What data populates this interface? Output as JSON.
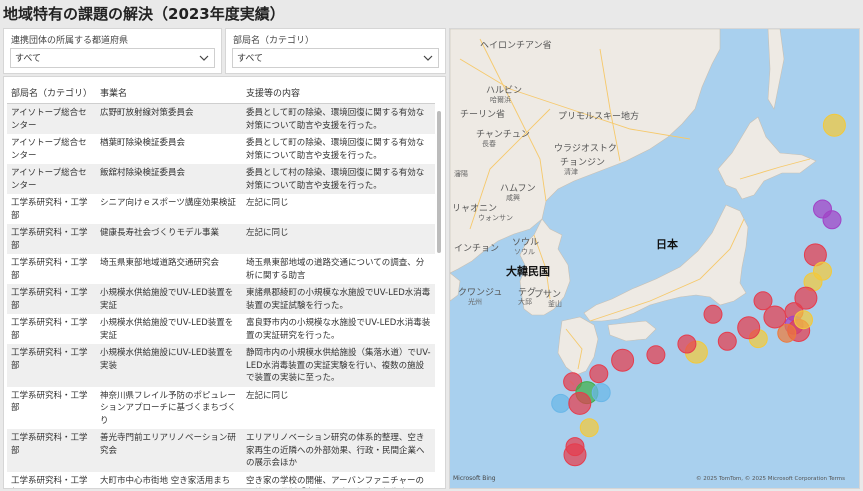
{
  "title": "地域特有の課題の解決（2023年度実績）",
  "slicer_pref": {
    "label": "連携団体の所属する都道府県",
    "value": "すべて"
  },
  "slicer_dept": {
    "label": "部局名（カテゴリ）",
    "value": "すべて"
  },
  "table": {
    "headers": [
      "部局名（カテゴリ）",
      "事業名",
      "支援等の内容"
    ],
    "rows": [
      [
        "アイソトープ総合センター",
        "広野町放射線対策委員会",
        "委員として町の除染、環境回復に関する有効な対策について助言や支援を行った。"
      ],
      [
        "アイソトープ総合センター",
        "楢葉町除染検証委員会",
        "委員として町の除染、環境回復に関する有効な対策について助言や支援を行った。"
      ],
      [
        "アイソトープ総合センター",
        "飯舘村除染検証委員会",
        "委員として村の除染、環境回復に関する有効な対策について助言や支援を行った。"
      ],
      [
        "工学系研究科・工学部",
        "シニア向けｅスポーツ講座効果検証",
        "左記に同じ"
      ],
      [
        "工学系研究科・工学部",
        "健康長寿社会づくりモデル事業",
        "左記に同じ"
      ],
      [
        "工学系研究科・工学部",
        "埼玉県東部地域道路交通研究会",
        "埼玉県東部地域の道路交通についての調査、分析に関する助言"
      ],
      [
        "工学系研究科・工学部",
        "小規模水供給施設でUV-LED装置を実証",
        "東諸県郡綾町の小規模な水施設でUV-LED水消毒装置の実証試験を行った。"
      ],
      [
        "工学系研究科・工学部",
        "小規模水供給施設でUV-LED装置を実証",
        "富良野市内の小規模な水施設でUV-LED水消毒装置の実証研究を行った。"
      ],
      [
        "工学系研究科・工学部",
        "小規模水供給施設にUV-LED装置を実装",
        "静岡市内の小規模水供給施設（集落水道）でUV-LED水消毒装置の実証実験を行い、複数の施設で装置の実装に至った。"
      ],
      [
        "工学系研究科・工学部",
        "神奈川県フレイル予防のポピュレーションアプローチに基づくまちづくり",
        "左記に同じ"
      ],
      [
        "工学系研究科・工学部",
        "善光寺門前エリアリノベーション研究会",
        "エリアリノベーション研究の体系的整理、空き家再生の近隣への外部効果、行政・民間企業への展示会ほか"
      ],
      [
        "工学系研究科・工学部",
        "大町市中心市街地 空き家活用まちづくり",
        "空き家の学校の開催、アーバンファニチャーの開催、現代版「家守」の全国調査、報告会の開催、広報誌へのシリーズ寄稿、ほか"
      ]
    ]
  },
  "map": {
    "labels": {
      "heilongjiang": "ヘイロンチアン省",
      "harbin": "ハルビン",
      "harbin_city": "哈爾浜",
      "jilin": "チーリン省",
      "changchun": "チャンチュン",
      "changchun_city": "長春",
      "primorsky": "プリモルスキー地方",
      "vladivostok": "ウラジオストク",
      "cheongjin": "チョンジン",
      "cheongjin_city": "清津",
      "shenyang": "瀋陽",
      "hamhung": "ハムフン",
      "hamhung_city": "咸興",
      "liaoning": "リャオニン",
      "korea_sea": "ウォンサン",
      "seoul": "ソウル",
      "seoul_city": "ソウル",
      "incheon": "インチョン",
      "south_korea": "大韓民国",
      "japan": "日本",
      "gwangju": "クワンジュ",
      "gwangju_city": "光州",
      "daegu": "テグ",
      "busan": "プサン",
      "busan_city": "釜山",
      "daegu_city": "大邱"
    },
    "attribution": "© 2025 TomTom, © 2025 Microsoft Corporation  Terms",
    "logo": "Microsoft Bing",
    "colors": {
      "sea": "#a9d0ee",
      "land": "#eeeae4",
      "road": "#f6c96b"
    },
    "bubbles": [
      {
        "lon": 141.4,
        "lat": 43.1,
        "color": "#f3c93b"
      },
      {
        "lon": 140.9,
        "lat": 40.0,
        "color": "#a142c6"
      },
      {
        "lon": 141.3,
        "lat": 39.6,
        "color": "#a142c6"
      },
      {
        "lon": 140.6,
        "lat": 38.3,
        "color": "#e53d4e"
      },
      {
        "lon": 140.9,
        "lat": 37.7,
        "color": "#f3c93b"
      },
      {
        "lon": 140.5,
        "lat": 37.3,
        "color": "#f3c93b"
      },
      {
        "lon": 140.2,
        "lat": 36.7,
        "color": "#e53d4e"
      },
      {
        "lon": 139.7,
        "lat": 36.2,
        "color": "#e53d4e"
      },
      {
        "lon": 139.7,
        "lat": 35.7,
        "color": "#a142c6"
      },
      {
        "lon": 139.9,
        "lat": 35.5,
        "color": "#e53d4e"
      },
      {
        "lon": 140.1,
        "lat": 35.9,
        "color": "#f3c93b"
      },
      {
        "lon": 139.4,
        "lat": 35.4,
        "color": "#ed7a3a"
      },
      {
        "lon": 138.9,
        "lat": 36.0,
        "color": "#e53d4e"
      },
      {
        "lon": 138.4,
        "lat": 36.6,
        "color": "#e53d4e"
      },
      {
        "lon": 138.2,
        "lat": 35.2,
        "color": "#f3c93b"
      },
      {
        "lon": 137.8,
        "lat": 35.6,
        "color": "#e53d4e"
      },
      {
        "lon": 136.9,
        "lat": 35.1,
        "color": "#e53d4e"
      },
      {
        "lon": 136.3,
        "lat": 36.1,
        "color": "#e53d4e"
      },
      {
        "lon": 135.6,
        "lat": 34.7,
        "color": "#f3c93b"
      },
      {
        "lon": 135.2,
        "lat": 35.0,
        "color": "#e53d4e"
      },
      {
        "lon": 133.9,
        "lat": 34.6,
        "color": "#e53d4e"
      },
      {
        "lon": 132.5,
        "lat": 34.4,
        "color": "#e53d4e"
      },
      {
        "lon": 131.5,
        "lat": 33.9,
        "color": "#e53d4e"
      },
      {
        "lon": 130.4,
        "lat": 33.6,
        "color": "#e53d4e"
      },
      {
        "lon": 131.0,
        "lat": 33.2,
        "color": "#3fae49"
      },
      {
        "lon": 131.6,
        "lat": 33.2,
        "color": "#6ab7e8"
      },
      {
        "lon": 129.9,
        "lat": 32.8,
        "color": "#6ab7e8"
      },
      {
        "lon": 130.7,
        "lat": 32.8,
        "color": "#e53d4e"
      },
      {
        "lon": 131.1,
        "lat": 31.9,
        "color": "#f3c93b"
      },
      {
        "lon": 130.5,
        "lat": 31.2,
        "color": "#e53d4e"
      },
      {
        "lon": 130.5,
        "lat": 30.9,
        "color": "#e53d4e"
      }
    ]
  }
}
